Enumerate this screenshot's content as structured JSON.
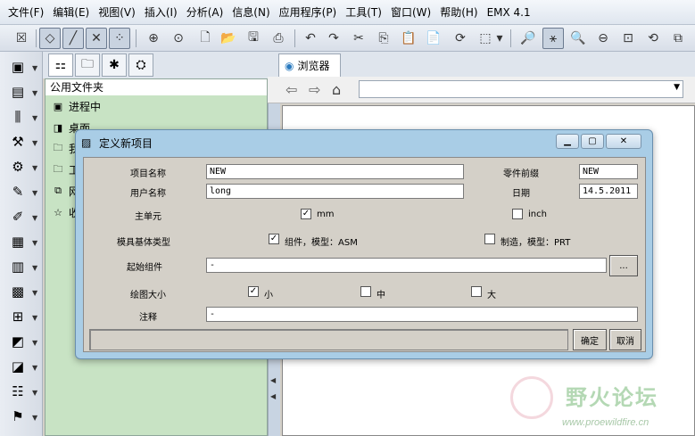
{
  "menubar": {
    "items": [
      "文件(F)",
      "编辑(E)",
      "视图(V)",
      "插入(I)",
      "分析(A)",
      "信息(N)",
      "应用程序(P)",
      "工具(T)",
      "窗口(W)",
      "帮助(H)",
      "EMX 4.1"
    ]
  },
  "navigator": {
    "header": "公用文件夹",
    "items": [
      {
        "label": "进程中",
        "icon": "monitor-icon"
      },
      {
        "label": "桌面",
        "icon": "desktop-icon"
      },
      {
        "label": "我",
        "icon": "folder-icon"
      },
      {
        "label": "工",
        "icon": "folder-icon"
      },
      {
        "label": "网",
        "icon": "network-icon"
      },
      {
        "label": "收",
        "icon": "favorites-icon"
      }
    ]
  },
  "browser": {
    "tab_label": "浏览器"
  },
  "dialog": {
    "title": "定义新项目",
    "project_name_label": "项目名称",
    "project_name_value": "NEW",
    "part_prefix_label": "零件前缀",
    "part_prefix_value": "NEW",
    "user_name_label": "用户名称",
    "user_name_value": "long",
    "date_label": "日期",
    "date_value": "14.5.2011",
    "main_unit_label": "主单元",
    "unit_mm_label": "mm",
    "unit_mm_checked": true,
    "unit_inch_label": "inch",
    "unit_inch_checked": false,
    "mold_type_label": "模具基体类型",
    "mold_assembly_label": "组件，模型：ASM",
    "mold_assembly_checked": true,
    "mold_manufacture_label": "制造，模型：PRT",
    "mold_manufacture_checked": false,
    "start_component_label": "起始组件",
    "start_component_value": "-",
    "browse_button": "...",
    "drawing_size_label": "绘图大小",
    "size_small_label": "小",
    "size_small_checked": true,
    "size_medium_label": "中",
    "size_medium_checked": false,
    "size_large_label": "大",
    "size_large_checked": false,
    "notes_label": "注释",
    "notes_value": "-",
    "ok_button": "确定",
    "cancel_button": "取消"
  },
  "watermark": {
    "title": "野火论坛",
    "url": "www.proewildfire.cn"
  },
  "colors": {
    "nav_panel": "#c8e3c4",
    "dialog_frame": "#a9cde6",
    "dialog_body": "#d4d0c8"
  }
}
